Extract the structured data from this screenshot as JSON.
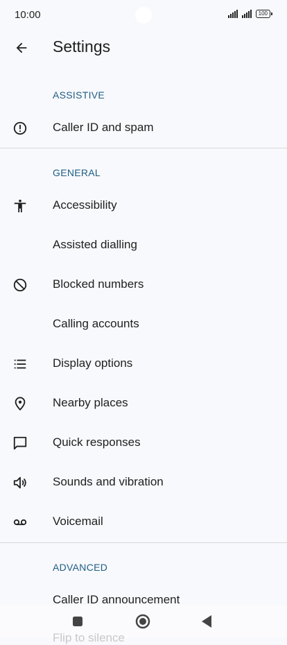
{
  "status": {
    "time": "10:00",
    "battery": "100"
  },
  "header": {
    "title": "Settings"
  },
  "sections": [
    {
      "title": "ASSISTIVE",
      "items": [
        {
          "label": "Caller ID and spam",
          "icon": "alert-circle-icon"
        }
      ]
    },
    {
      "title": "GENERAL",
      "items": [
        {
          "label": "Accessibility",
          "icon": "accessibility-icon"
        },
        {
          "label": "Assisted dialling",
          "icon": ""
        },
        {
          "label": "Blocked numbers",
          "icon": "block-icon"
        },
        {
          "label": "Calling accounts",
          "icon": ""
        },
        {
          "label": "Display options",
          "icon": "list-icon"
        },
        {
          "label": "Nearby places",
          "icon": "location-pin-icon"
        },
        {
          "label": "Quick responses",
          "icon": "message-icon"
        },
        {
          "label": "Sounds and vibration",
          "icon": "volume-icon"
        },
        {
          "label": "Voicemail",
          "icon": "voicemail-icon"
        }
      ]
    },
    {
      "title": "ADVANCED",
      "items": [
        {
          "label": "Caller ID announcement",
          "icon": ""
        },
        {
          "label": "Flip to silence",
          "icon": ""
        }
      ]
    }
  ],
  "colors": {
    "section_header": "#1e5d84",
    "background": "#f8f9fc"
  }
}
